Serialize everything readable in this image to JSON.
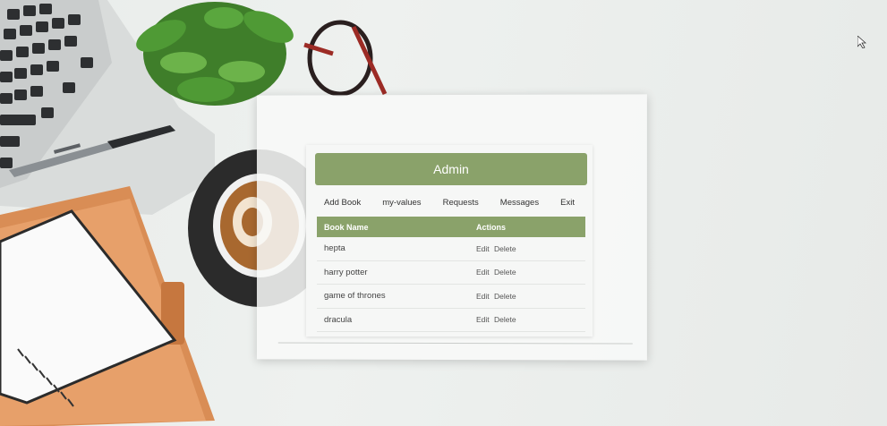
{
  "admin_panel": {
    "title": "Admin",
    "nav": [
      {
        "label": "Add Book"
      },
      {
        "label": "my-values"
      },
      {
        "label": "Requests"
      },
      {
        "label": "Messages"
      },
      {
        "label": "Exit"
      }
    ],
    "table": {
      "headers": {
        "name": "Book Name",
        "actions": "Actions"
      },
      "rows": [
        {
          "name": "hepta",
          "edit": "Edit",
          "delete": "Delete"
        },
        {
          "name": "harry potter",
          "edit": "Edit",
          "delete": "Delete"
        },
        {
          "name": "game of thrones",
          "edit": "Edit",
          "delete": "Delete"
        },
        {
          "name": "dracula",
          "edit": "Edit",
          "delete": "Delete"
        }
      ]
    }
  },
  "colors": {
    "accent": "#8aa26a",
    "card_bg": "#f6f7f6"
  }
}
